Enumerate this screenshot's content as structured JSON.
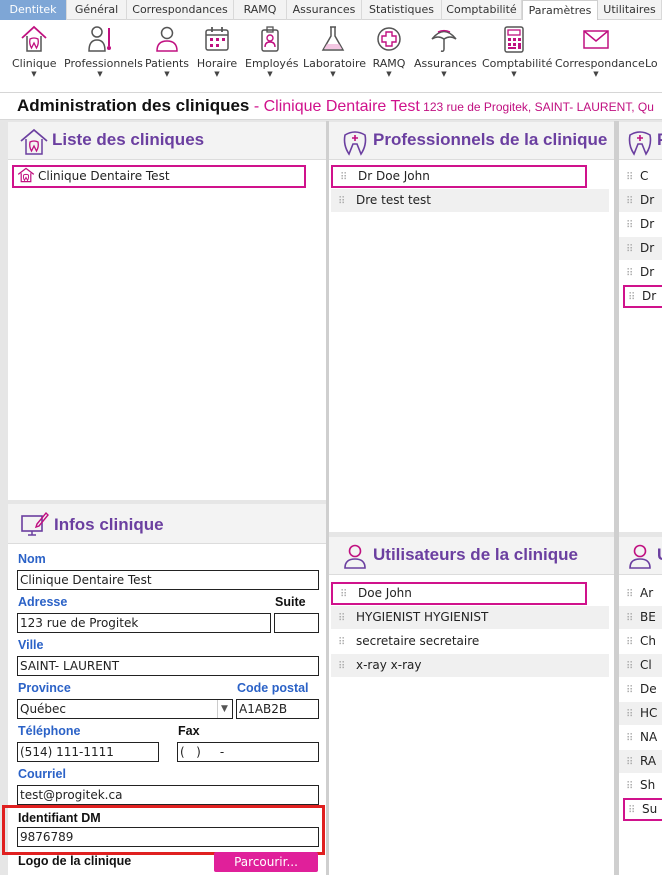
{
  "menu_tabs": [
    "Dentitek",
    "Général",
    "Correspondances",
    "RAMQ",
    "Assurances",
    "Statistiques",
    "Comptabilité",
    "Paramètres",
    "Utilitaires"
  ],
  "ribbon": [
    "Clinique",
    "Professionnels",
    "Patients",
    "Horaire",
    "Employés",
    "Laboratoire",
    "RAMQ",
    "Assurances",
    "Comptabilité",
    "Correspondance",
    "Lo"
  ],
  "title": {
    "main": "Administration des cliniques",
    "clinic": " - Clinique Dentaire Test",
    "address": " 123 rue de Progitek, SAINT- LAURENT, Qu"
  },
  "clinics_panel": {
    "title": "Liste des cliniques",
    "items": [
      "Clinique Dentaire Test"
    ]
  },
  "pros_panel": {
    "title": "Professionnels de la clinique",
    "items": [
      "Dr Doe John",
      "Dre test test"
    ]
  },
  "right_top_panel": {
    "title": "P",
    "items": [
      "C",
      "Dr",
      "Dr",
      "Dr",
      "Dr",
      "Dr"
    ]
  },
  "users_panel": {
    "title": "Utilisateurs de la clinique",
    "items": [
      "Doe John",
      "HYGIENIST HYGIENIST",
      "secretaire secretaire",
      "x-ray x-ray"
    ]
  },
  "right_bottom_panel": {
    "title": "U",
    "items": [
      "Ar",
      "BE",
      "Ch",
      "Cl",
      "De",
      "HC",
      "NA",
      "RA",
      "Sh",
      "Su"
    ]
  },
  "info_panel": {
    "title": "Infos clinique",
    "labels": {
      "nom": "Nom",
      "adresse": "Adresse",
      "suite": "Suite",
      "ville": "Ville",
      "province": "Province",
      "code_postal": "Code postal",
      "telephone": "Téléphone",
      "fax": "Fax",
      "courriel": "Courriel",
      "identifiant": "Identifiant DM",
      "logo": "Logo de la clinique",
      "browse": "Parcourir..."
    },
    "values": {
      "nom": "Clinique Dentaire Test",
      "adresse": "123 rue de Progitek",
      "suite": "",
      "ville": "SAINT- LAURENT",
      "province": "Québec",
      "code_postal": "A1AB2B",
      "telephone": "(514) 111-1111",
      "fax": "(   )     -",
      "courriel": "test@progitek.ca",
      "identifiant": "9876789"
    }
  },
  "colors": {
    "accent": "#d0128c",
    "heading": "#6b3fa0",
    "label": "#2b62c7",
    "highlight_box": "#e02020"
  },
  "icons": [
    "tooth-icon",
    "professional-icon",
    "patient-icon",
    "calendar-icon",
    "employee-icon",
    "flask-icon",
    "ramq-cross-icon",
    "umbrella-icon",
    "calculator-icon",
    "envelope-icon",
    "edit-screen-icon",
    "user-icon"
  ]
}
